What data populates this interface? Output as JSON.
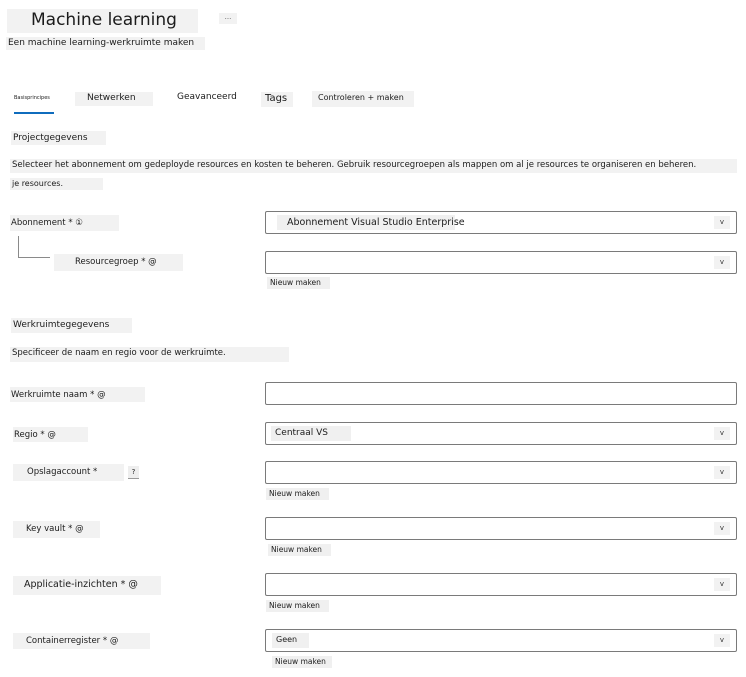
{
  "header": {
    "title": "Machine learning",
    "more_label": "...",
    "subtitle": "Een machine learning-werkruimte maken"
  },
  "tabs": [
    {
      "label": "Basisprincipes",
      "selected": true
    },
    {
      "label": "Netwerken"
    },
    {
      "label": "Geavanceerd"
    },
    {
      "label": "Tags"
    },
    {
      "label": "Controleren + maken"
    }
  ],
  "project": {
    "heading": "Projectgegevens",
    "description_line1": "Selecteer het abonnement om gedeployde resources en kosten te beheren. Gebruik resourcegroepen als mappen om al je resources te organiseren en beheren.",
    "description_line2": "je resources.",
    "subscription_label": "Abonnement * ①",
    "subscription_value": "Abonnement Visual Studio Enterprise",
    "resource_group_label": "Resourcegroep * @",
    "resource_group_value": "",
    "new_label": "Nieuw maken"
  },
  "workspace": {
    "heading": "Werkruimtegegevens",
    "description": "Specificeer de naam en regio voor de werkruimte.",
    "name_label": "Werkruimte naam * @",
    "name_value": "",
    "region_label": "Regio * @",
    "region_value": "Centraal VS",
    "storage_label": "Opslagaccount *",
    "storage_help": "?",
    "storage_value": "",
    "keyvault_label": "Key vault * @",
    "keyvault_value": "",
    "insights_label": "Applicatie-inzichten * @",
    "insights_value": "",
    "registry_label": "Containerregister * @",
    "registry_value": "Geen",
    "new_label": "Nieuw maken"
  },
  "dropdown_glyph": "v",
  "colors": {
    "accent": "#0f6cbd",
    "field_border": "#7a7a7a",
    "chip_background": "#f2f2f2"
  }
}
